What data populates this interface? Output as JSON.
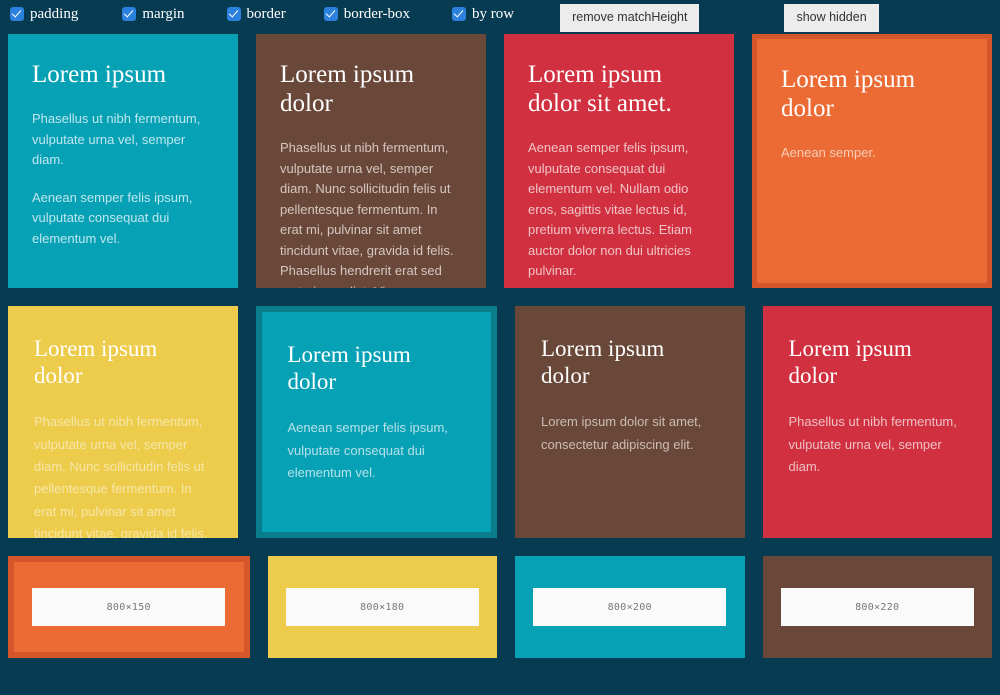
{
  "toolbar": {
    "options": [
      {
        "label": "padding",
        "checked": true,
        "icon": "checkbox-checked-icon"
      },
      {
        "label": "margin",
        "checked": true,
        "icon": "checkbox-checked-icon"
      },
      {
        "label": "border",
        "checked": true,
        "icon": "checkbox-checked-icon"
      },
      {
        "label": "border-box",
        "checked": true,
        "icon": "checkbox-checked-icon"
      },
      {
        "label": "by row",
        "checked": true,
        "icon": "checkbox-checked-icon"
      }
    ],
    "remove_button": "remove matchHeight",
    "show_button": "show hidden"
  },
  "colors": {
    "page_background": "#073b52",
    "teal": "#06a1b5",
    "teal_border": "#0a7d8c",
    "brown": "#69483a",
    "red": "#d0303f",
    "orange": "#ec6b35",
    "orange_border": "#d4562a",
    "yellow": "#edcc4b",
    "checkbox": "#2b81dd",
    "button_background": "#ececec",
    "button_text": "#333333",
    "placeholder_background": "#fafafa",
    "placeholder_text": "#777777"
  },
  "rows": [
    {
      "name": "row-1",
      "cards": [
        {
          "id": "card-1",
          "background": "#06a1b5",
          "border_color": "#06a1b5",
          "border_width": 0,
          "text_color": "#bfe7ee",
          "heading": "Lorem ipsum",
          "paragraphs": [
            "Phasellus ut nibh fermentum, vulputate urna vel, semper diam.",
            "Aenean semper felis ipsum, vulputate consequat dui elementum vel."
          ]
        },
        {
          "id": "card-2",
          "background": "#69483a",
          "border_color": "#69483a",
          "border_width": 0,
          "text_color": "#d6c6bf",
          "heading": "Lorem ipsum dolor",
          "paragraphs": [
            "Phasellus ut nibh fermentum, vulputate urna vel, semper diam. Nunc sollicitudin felis ut pellentesque fermentum. In erat mi, pulvinar sit amet tincidunt vitae, gravida id felis. Phasellus hendrerit erat sed porta imperdiet. Vivamus viverra ipsum tortor, et congue mauris porttitor ut."
          ]
        },
        {
          "id": "card-3",
          "background": "#d0303f",
          "border_color": "#d0303f",
          "border_width": 0,
          "text_color": "#f0c3c7",
          "heading": "Lorem ipsum dolor sit amet.",
          "paragraphs": [
            "Aenean semper felis ipsum, vulputate consequat dui elementum vel. Nullam odio eros, sagittis vitae lectus id, pretium viverra lectus. Etiam auctor dolor non dui ultricies pulvinar."
          ]
        },
        {
          "id": "card-4",
          "background": "#ec6b35",
          "border_color": "#d4562a",
          "border_width": 5,
          "text_color": "#f7cdb8",
          "heading": "Lorem ipsum dolor",
          "paragraphs": [
            "Aenean semper."
          ]
        }
      ]
    },
    {
      "name": "row-2",
      "cards": [
        {
          "id": "card-5",
          "background": "#edcc4b",
          "border_color": "#edcc4b",
          "border_width": 0,
          "text_color": "#f6e6a9",
          "heading": "Lorem ipsum dolor",
          "paragraphs": [
            "Phasellus ut nibh fermentum, vulputate urna vel, semper diam. Nunc sollicitudin felis ut pellentesque fermentum. In erat mi, pulvinar sit amet tincidunt vitae, gravida id felis."
          ]
        },
        {
          "id": "card-6",
          "background": "#06a1b5",
          "border_color": "#0a7d8c",
          "border_width": 6,
          "text_color": "#b5e2e9",
          "heading": "Lorem ipsum dolor",
          "paragraphs": [
            "Aenean semper felis ipsum, vulputate consequat dui elementum vel."
          ]
        },
        {
          "id": "card-7",
          "background": "#69483a",
          "border_color": "#69483a",
          "border_width": 0,
          "text_color": "#cdbcb4",
          "heading": "Lorem ipsum dolor",
          "paragraphs": [
            "Lorem ipsum dolor sit amet, consectetur adipiscing elit."
          ]
        },
        {
          "id": "card-8",
          "background": "#d0303f",
          "border_color": "#d0303f",
          "border_width": 0,
          "text_color": "#eec0c4",
          "heading": "Lorem ipsum dolor",
          "paragraphs": [
            "Phasellus ut nibh fermentum, vulputate urna vel, semper diam."
          ]
        }
      ]
    }
  ],
  "image_cards": [
    {
      "id": "image-card-1",
      "background": "#ec6b35",
      "border_color": "#d4562a",
      "border_width": 6,
      "label": "800×150"
    },
    {
      "id": "image-card-2",
      "background": "#edcc4b",
      "border_color": "#edcc4b",
      "border_width": 0,
      "label": "800×180"
    },
    {
      "id": "image-card-3",
      "background": "#06a1b5",
      "border_color": "#06a1b5",
      "border_width": 0,
      "label": "800×200"
    },
    {
      "id": "image-card-4",
      "background": "#69483a",
      "border_color": "#69483a",
      "border_width": 0,
      "label": "800×220"
    }
  ]
}
